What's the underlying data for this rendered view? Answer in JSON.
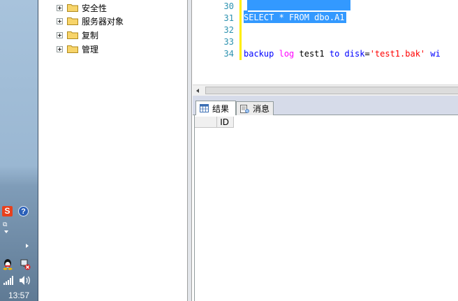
{
  "taskbar": {
    "clock": "13:57",
    "tray_icons": [
      "sogou-ime-icon",
      "help-icon",
      "restore-icon",
      "chevron-down-icon",
      "chevron-right-icon",
      "qq-icon",
      "network-disconnected-icon",
      "signal-icon",
      "volume-icon"
    ],
    "sogou_letter": "S",
    "help_glyph": "?"
  },
  "explorer": {
    "items": [
      {
        "label": "安全性"
      },
      {
        "label": "服务器对象"
      },
      {
        "label": "复制"
      },
      {
        "label": "管理"
      }
    ]
  },
  "editor": {
    "line_numbers": [
      "30",
      "31",
      "32",
      "33",
      "34"
    ],
    "lines": {
      "l31": {
        "select": "SELECT",
        "star": " * ",
        "from": "FROM",
        "table": " dbo.A1"
      },
      "l34": {
        "backup": "backup",
        "log": "log",
        "db": " test1 ",
        "to": "to",
        "disk": "disk",
        "eq": "=",
        "path": "'test1.bak'",
        "trail": " wi"
      }
    }
  },
  "results": {
    "tabs": [
      {
        "label": "结果",
        "active": true
      },
      {
        "label": "消息",
        "active": false
      }
    ],
    "columns": [
      "ID"
    ]
  },
  "colors": {
    "selection": "#3399ff",
    "keyword": "#0000ff",
    "string": "#ff0000",
    "line_numbers": "#2b91af",
    "changed_line_marker": "#ffee00"
  }
}
